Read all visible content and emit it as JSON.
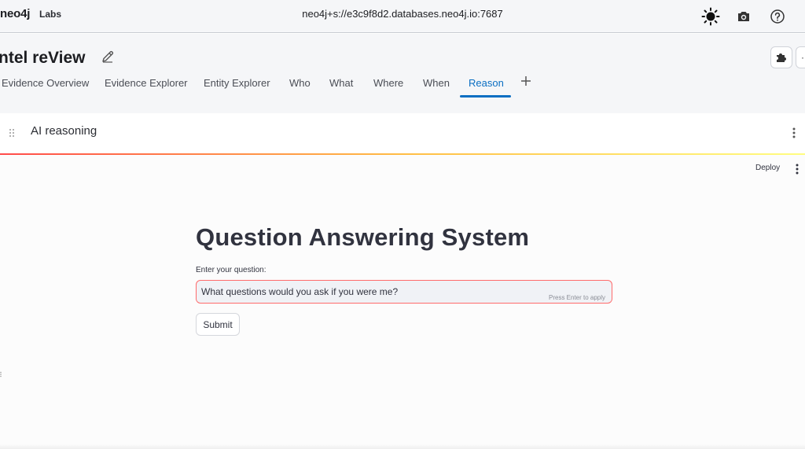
{
  "topbar": {
    "logo": "neo4j",
    "labs": "Labs",
    "connection": "neo4j+s://e3c9f8d2.databases.neo4j.io:7687"
  },
  "dashboard": {
    "title": "ntel reView",
    "tabs": [
      {
        "label": "Evidence Overview"
      },
      {
        "label": "Evidence Explorer"
      },
      {
        "label": "Entity Explorer"
      },
      {
        "label": "Who"
      },
      {
        "label": "What"
      },
      {
        "label": "Where"
      },
      {
        "label": "When"
      },
      {
        "label": "Reason",
        "active": true
      }
    ],
    "more_label": "···"
  },
  "report": {
    "title": "AI reasoning"
  },
  "app": {
    "deploy_label": "Deploy",
    "heading": "Question Answering System",
    "input_label": "Enter your question:",
    "input_value": "What questions would you ask if you were me?",
    "input_hint": "Press Enter to apply",
    "submit_label": "Submit"
  },
  "colors": {
    "accent": "#0a6ec2",
    "input_border": "#ff6b6b",
    "gradient_start": "#ff4b4b",
    "gradient_end": "#fffd80"
  }
}
